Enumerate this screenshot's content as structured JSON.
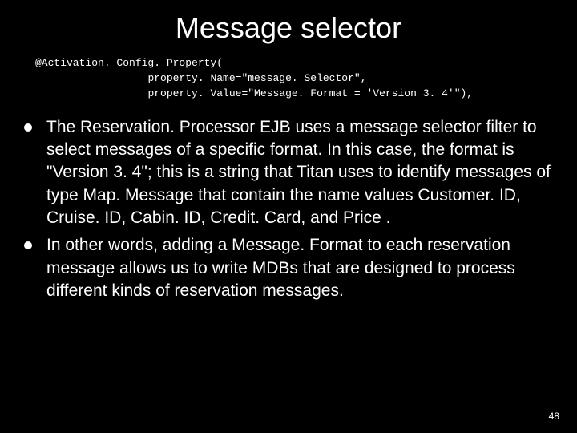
{
  "title": "Message selector",
  "code": {
    "line1": "@Activation. Config. Property(",
    "line2": "property. Name=\"message. Selector\",",
    "line3": "property. Value=\"Message. Format = 'Version 3. 4'\"),"
  },
  "bullets": [
    "The Reservation. Processor EJB uses a message selector filter to select messages of a specific format. In this case, the format is \"Version 3. 4\"; this is a string that Titan uses to identify messages of type Map. Message that contain the name values Customer. ID, Cruise. ID, Cabin. ID, Credit. Card, and Price .",
    "In other words, adding a Message. Format to each reservation message allows us to write MDBs that are designed to process different kinds of reservation messages."
  ],
  "page_number": "48"
}
